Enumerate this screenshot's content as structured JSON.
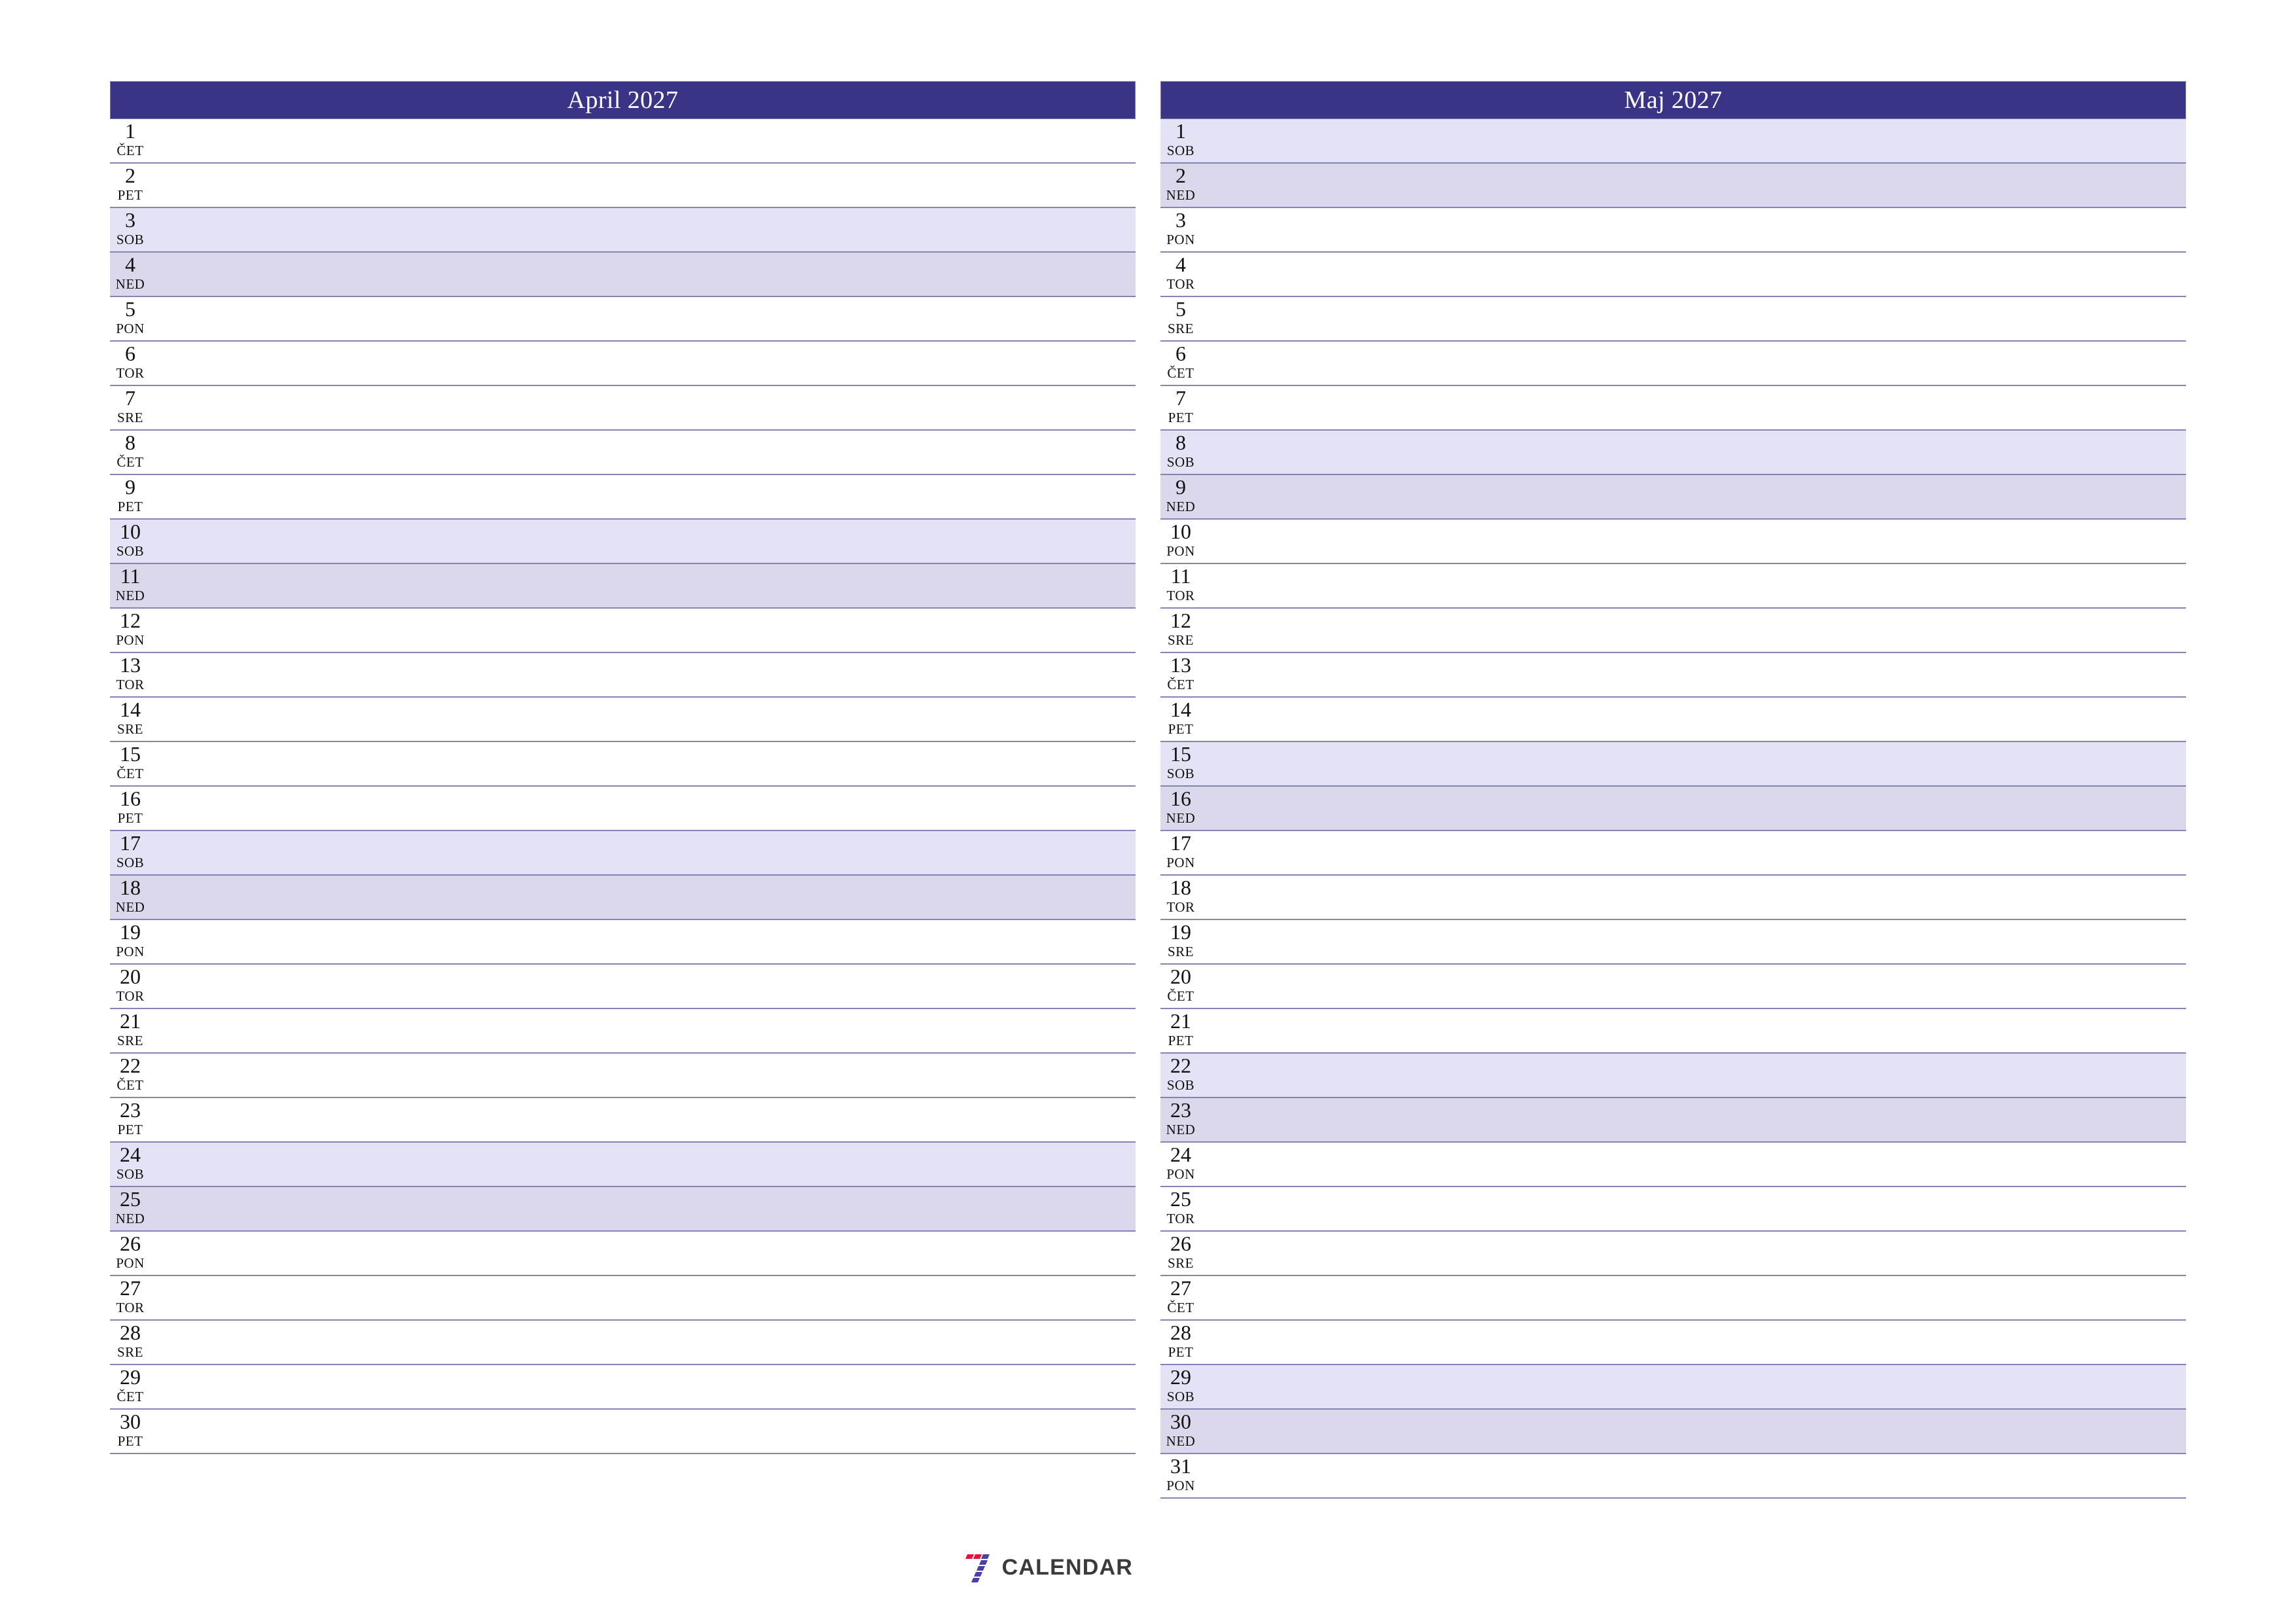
{
  "page": {
    "type": "printable-monthly-planner",
    "language": "sl",
    "background_color": "#ffffff"
  },
  "theme": {
    "header_bg": "#3a3487",
    "header_text": "#ffffff",
    "row_line": "#8582b4",
    "saturday_bg": "#e3e3f5",
    "sunday_bg": "#dcd8ec",
    "weekday_bg": "#ffffff",
    "text": "#111111",
    "logo_red": "#e8133a",
    "logo_purple": "#4b3fa8",
    "logo_wordmark": "#3b3b3f"
  },
  "footer": {
    "logo_icon": "seven-bars-logo-icon",
    "logo_text": "CALENDAR"
  },
  "months": [
    {
      "title": "April 2027",
      "days": [
        {
          "num": "1",
          "dow": "ČET",
          "kind": "weekday"
        },
        {
          "num": "2",
          "dow": "PET",
          "kind": "weekday"
        },
        {
          "num": "3",
          "dow": "SOB",
          "kind": "sat"
        },
        {
          "num": "4",
          "dow": "NED",
          "kind": "sun"
        },
        {
          "num": "5",
          "dow": "PON",
          "kind": "weekday"
        },
        {
          "num": "6",
          "dow": "TOR",
          "kind": "weekday"
        },
        {
          "num": "7",
          "dow": "SRE",
          "kind": "weekday"
        },
        {
          "num": "8",
          "dow": "ČET",
          "kind": "weekday"
        },
        {
          "num": "9",
          "dow": "PET",
          "kind": "weekday"
        },
        {
          "num": "10",
          "dow": "SOB",
          "kind": "sat"
        },
        {
          "num": "11",
          "dow": "NED",
          "kind": "sun"
        },
        {
          "num": "12",
          "dow": "PON",
          "kind": "weekday"
        },
        {
          "num": "13",
          "dow": "TOR",
          "kind": "weekday"
        },
        {
          "num": "14",
          "dow": "SRE",
          "kind": "weekday"
        },
        {
          "num": "15",
          "dow": "ČET",
          "kind": "weekday"
        },
        {
          "num": "16",
          "dow": "PET",
          "kind": "weekday"
        },
        {
          "num": "17",
          "dow": "SOB",
          "kind": "sat"
        },
        {
          "num": "18",
          "dow": "NED",
          "kind": "sun"
        },
        {
          "num": "19",
          "dow": "PON",
          "kind": "weekday"
        },
        {
          "num": "20",
          "dow": "TOR",
          "kind": "weekday"
        },
        {
          "num": "21",
          "dow": "SRE",
          "kind": "weekday"
        },
        {
          "num": "22",
          "dow": "ČET",
          "kind": "weekday"
        },
        {
          "num": "23",
          "dow": "PET",
          "kind": "weekday"
        },
        {
          "num": "24",
          "dow": "SOB",
          "kind": "sat"
        },
        {
          "num": "25",
          "dow": "NED",
          "kind": "sun"
        },
        {
          "num": "26",
          "dow": "PON",
          "kind": "weekday"
        },
        {
          "num": "27",
          "dow": "TOR",
          "kind": "weekday"
        },
        {
          "num": "28",
          "dow": "SRE",
          "kind": "weekday"
        },
        {
          "num": "29",
          "dow": "ČET",
          "kind": "weekday"
        },
        {
          "num": "30",
          "dow": "PET",
          "kind": "weekday"
        }
      ]
    },
    {
      "title": "Maj 2027",
      "days": [
        {
          "num": "1",
          "dow": "SOB",
          "kind": "sat"
        },
        {
          "num": "2",
          "dow": "NED",
          "kind": "sun"
        },
        {
          "num": "3",
          "dow": "PON",
          "kind": "weekday"
        },
        {
          "num": "4",
          "dow": "TOR",
          "kind": "weekday"
        },
        {
          "num": "5",
          "dow": "SRE",
          "kind": "weekday"
        },
        {
          "num": "6",
          "dow": "ČET",
          "kind": "weekday"
        },
        {
          "num": "7",
          "dow": "PET",
          "kind": "weekday"
        },
        {
          "num": "8",
          "dow": "SOB",
          "kind": "sat"
        },
        {
          "num": "9",
          "dow": "NED",
          "kind": "sun"
        },
        {
          "num": "10",
          "dow": "PON",
          "kind": "weekday"
        },
        {
          "num": "11",
          "dow": "TOR",
          "kind": "weekday"
        },
        {
          "num": "12",
          "dow": "SRE",
          "kind": "weekday"
        },
        {
          "num": "13",
          "dow": "ČET",
          "kind": "weekday"
        },
        {
          "num": "14",
          "dow": "PET",
          "kind": "weekday"
        },
        {
          "num": "15",
          "dow": "SOB",
          "kind": "sat"
        },
        {
          "num": "16",
          "dow": "NED",
          "kind": "sun"
        },
        {
          "num": "17",
          "dow": "PON",
          "kind": "weekday"
        },
        {
          "num": "18",
          "dow": "TOR",
          "kind": "weekday"
        },
        {
          "num": "19",
          "dow": "SRE",
          "kind": "weekday"
        },
        {
          "num": "20",
          "dow": "ČET",
          "kind": "weekday"
        },
        {
          "num": "21",
          "dow": "PET",
          "kind": "weekday"
        },
        {
          "num": "22",
          "dow": "SOB",
          "kind": "sat"
        },
        {
          "num": "23",
          "dow": "NED",
          "kind": "sun"
        },
        {
          "num": "24",
          "dow": "PON",
          "kind": "weekday"
        },
        {
          "num": "25",
          "dow": "TOR",
          "kind": "weekday"
        },
        {
          "num": "26",
          "dow": "SRE",
          "kind": "weekday"
        },
        {
          "num": "27",
          "dow": "ČET",
          "kind": "weekday"
        },
        {
          "num": "28",
          "dow": "PET",
          "kind": "weekday"
        },
        {
          "num": "29",
          "dow": "SOB",
          "kind": "sat"
        },
        {
          "num": "30",
          "dow": "NED",
          "kind": "sun"
        },
        {
          "num": "31",
          "dow": "PON",
          "kind": "weekday"
        }
      ]
    }
  ]
}
